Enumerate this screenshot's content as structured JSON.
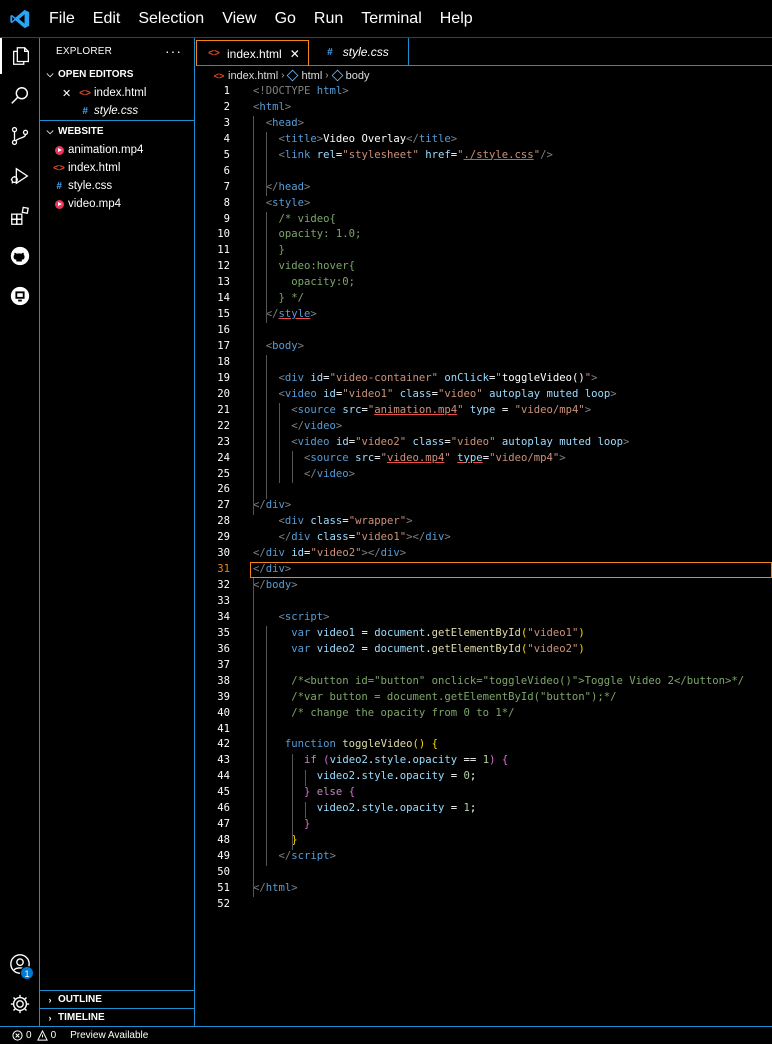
{
  "menu": [
    "File",
    "Edit",
    "Selection",
    "View",
    "Go",
    "Run",
    "Terminal",
    "Help"
  ],
  "activity": {
    "icons": [
      "explorer-icon",
      "search-icon",
      "source-control-icon",
      "run-debug-icon",
      "extensions-icon",
      "github-icon",
      "remote-explorer-icon"
    ],
    "accounts_badge": "1"
  },
  "sidebar": {
    "title": "EXPLORER",
    "more": "···",
    "open_editors": {
      "label": "OPEN EDITORS",
      "items": [
        {
          "name": "index.html",
          "type": "html",
          "close": "✕"
        },
        {
          "name": "style.css",
          "type": "css"
        }
      ]
    },
    "workspace": {
      "label": "WEBSITE",
      "items": [
        {
          "name": "animation.mp4",
          "type": "mp4"
        },
        {
          "name": "index.html",
          "type": "html"
        },
        {
          "name": "style.css",
          "type": "css"
        },
        {
          "name": "video.mp4",
          "type": "mp4"
        }
      ]
    },
    "outline_label": "OUTLINE",
    "timeline_label": "TIMELINE"
  },
  "tabs": [
    {
      "label": "index.html",
      "icon": "<>",
      "close": "✕"
    },
    {
      "label": "style.css",
      "icon": "#"
    }
  ],
  "breadcrumb": [
    "index.html",
    "html",
    "body"
  ],
  "status": {
    "errors": "0",
    "warnings": "0",
    "preview": "Preview Available"
  },
  "colors": {
    "accent": "#1b8fd0",
    "active_border": "#f38518",
    "background": "#000000"
  },
  "editor": {
    "current_line": 31,
    "lines": [
      {
        "n": "1",
        "t": [
          [
            "<!DOCTYPE ",
            "g"
          ],
          [
            "html",
            "k"
          ],
          [
            ">",
            "g"
          ]
        ]
      },
      {
        "n": "2",
        "t": [
          [
            "<",
            "g"
          ],
          [
            "html",
            "t"
          ],
          [
            ">",
            "g"
          ]
        ]
      },
      {
        "n": "3",
        "t": [
          [
            "  <",
            "g"
          ],
          [
            "head",
            "t"
          ],
          [
            ">",
            "g"
          ]
        ]
      },
      {
        "n": "4",
        "t": [
          [
            "    <",
            "g"
          ],
          [
            "title",
            "t"
          ],
          [
            ">",
            "g"
          ],
          [
            "Video Overlay",
            "p"
          ],
          [
            "</",
            "g"
          ],
          [
            "title",
            "t"
          ],
          [
            ">",
            "g"
          ]
        ]
      },
      {
        "n": "5",
        "t": [
          [
            "    <",
            "g"
          ],
          [
            "link ",
            "t"
          ],
          [
            "rel",
            "a"
          ],
          [
            "=",
            "p"
          ],
          [
            "\"stylesheet\"",
            "s"
          ],
          [
            " href",
            "a"
          ],
          [
            "=",
            "p"
          ],
          [
            "\"",
            "s"
          ],
          [
            "./style.css",
            "su"
          ],
          [
            "\"",
            "s"
          ],
          [
            "/>",
            "g"
          ]
        ]
      },
      {
        "n": "6",
        "t": []
      },
      {
        "n": "7",
        "t": [
          [
            "  </",
            "g"
          ],
          [
            "head",
            "t"
          ],
          [
            ">",
            "g"
          ]
        ]
      },
      {
        "n": "8",
        "t": [
          [
            "  <",
            "g"
          ],
          [
            "style",
            "t"
          ],
          [
            ">",
            "g"
          ]
        ]
      },
      {
        "n": "9",
        "t": [
          [
            "    /* video{",
            "c"
          ]
        ]
      },
      {
        "n": "10",
        "t": [
          [
            "    opacity: 1.0;",
            "c"
          ]
        ]
      },
      {
        "n": "11",
        "t": [
          [
            "    }",
            "c"
          ]
        ]
      },
      {
        "n": "12",
        "t": [
          [
            "    video:hover{",
            "c"
          ]
        ]
      },
      {
        "n": "13",
        "t": [
          [
            "      opacity:0;",
            "c"
          ]
        ]
      },
      {
        "n": "14",
        "t": [
          [
            "    } */",
            "c"
          ]
        ]
      },
      {
        "n": "15",
        "t": [
          [
            "  </",
            "g"
          ],
          [
            "style",
            "tu"
          ],
          [
            ">",
            "g"
          ]
        ]
      },
      {
        "n": "16",
        "t": []
      },
      {
        "n": "17",
        "t": [
          [
            "  <",
            "g"
          ],
          [
            "body",
            "t"
          ],
          [
            ">",
            "g"
          ]
        ]
      },
      {
        "n": "18",
        "t": []
      },
      {
        "n": "19",
        "t": [
          [
            "    <",
            "g"
          ],
          [
            "div ",
            "t"
          ],
          [
            "id",
            "a"
          ],
          [
            "=",
            "p"
          ],
          [
            "\"video-container\"",
            "s"
          ],
          [
            " onClick",
            "a"
          ],
          [
            "=",
            "p"
          ],
          [
            "\"",
            "s"
          ],
          [
            "toggleVideo()",
            "p"
          ],
          [
            "\"",
            "s"
          ],
          [
            ">",
            "g"
          ]
        ]
      },
      {
        "n": "20",
        "t": [
          [
            "    <",
            "g"
          ],
          [
            "video ",
            "t"
          ],
          [
            "id",
            "a"
          ],
          [
            "=",
            "p"
          ],
          [
            "\"video1\"",
            "s"
          ],
          [
            " class",
            "a"
          ],
          [
            "=",
            "p"
          ],
          [
            "\"video\"",
            "s"
          ],
          [
            " autoplay muted loop",
            "a"
          ],
          [
            ">",
            "g"
          ]
        ]
      },
      {
        "n": "21",
        "t": [
          [
            "      <",
            "g"
          ],
          [
            "source ",
            "t"
          ],
          [
            "src",
            "a"
          ],
          [
            "=",
            "p"
          ],
          [
            "\"",
            "s"
          ],
          [
            "animation.mp4",
            "su"
          ],
          [
            "\"",
            "s"
          ],
          [
            " type ",
            "a"
          ],
          [
            "= ",
            "p"
          ],
          [
            "\"video/mp4\"",
            "s"
          ],
          [
            ">",
            "g"
          ]
        ]
      },
      {
        "n": "22",
        "t": [
          [
            "      </",
            "g"
          ],
          [
            "video",
            "t"
          ],
          [
            ">",
            "g"
          ]
        ]
      },
      {
        "n": "23",
        "t": [
          [
            "      <",
            "g"
          ],
          [
            "video ",
            "t"
          ],
          [
            "id",
            "a"
          ],
          [
            "=",
            "p"
          ],
          [
            "\"video2\"",
            "s"
          ],
          [
            " class",
            "a"
          ],
          [
            "=",
            "p"
          ],
          [
            "\"video\"",
            "s"
          ],
          [
            " autoplay muted loop",
            "a"
          ],
          [
            ">",
            "g"
          ]
        ]
      },
      {
        "n": "24",
        "t": [
          [
            "        <",
            "g"
          ],
          [
            "source ",
            "t"
          ],
          [
            "src",
            "a"
          ],
          [
            "=",
            "p"
          ],
          [
            "\"",
            "s"
          ],
          [
            "video.mp4",
            "su"
          ],
          [
            "\"",
            "s"
          ],
          [
            " ",
            "p"
          ],
          [
            "type",
            "au"
          ],
          [
            "=",
            "p"
          ],
          [
            "\"video/mp4\"",
            "s"
          ],
          [
            ">",
            "g"
          ]
        ]
      },
      {
        "n": "25",
        "t": [
          [
            "        </",
            "g"
          ],
          [
            "video",
            "t"
          ],
          [
            ">",
            "g"
          ]
        ]
      },
      {
        "n": "26",
        "t": []
      },
      {
        "n": "27",
        "t": [
          [
            "</",
            "g"
          ],
          [
            "div",
            "t"
          ],
          [
            ">",
            "g"
          ]
        ]
      },
      {
        "n": "28",
        "t": [
          [
            "    <",
            "g"
          ],
          [
            "div ",
            "t"
          ],
          [
            "class",
            "a"
          ],
          [
            "=",
            "p"
          ],
          [
            "\"wrapper\"",
            "s"
          ],
          [
            ">",
            "g"
          ]
        ]
      },
      {
        "n": "29",
        "t": [
          [
            "    </",
            "g"
          ],
          [
            "div ",
            "t"
          ],
          [
            "class",
            "a"
          ],
          [
            "=",
            "p"
          ],
          [
            "\"video1\"",
            "s"
          ],
          [
            "></",
            "g"
          ],
          [
            "div",
            "t"
          ],
          [
            ">",
            "g"
          ]
        ]
      },
      {
        "n": "30",
        "t": [
          [
            "</",
            "g"
          ],
          [
            "div ",
            "t"
          ],
          [
            "id",
            "a"
          ],
          [
            "=",
            "p"
          ],
          [
            "\"video2\"",
            "s"
          ],
          [
            "></",
            "g"
          ],
          [
            "div",
            "t"
          ],
          [
            ">",
            "g"
          ]
        ]
      },
      {
        "n": "31",
        "t": [
          [
            "</",
            "g"
          ],
          [
            "div",
            "t"
          ],
          [
            ">",
            "g"
          ]
        ]
      },
      {
        "n": "32",
        "t": [
          [
            "</",
            "g"
          ],
          [
            "body",
            "t"
          ],
          [
            ">",
            "g"
          ]
        ]
      },
      {
        "n": "33",
        "t": []
      },
      {
        "n": "34",
        "t": [
          [
            "    <",
            "g"
          ],
          [
            "script",
            "t"
          ],
          [
            ">",
            "g"
          ]
        ]
      },
      {
        "n": "35",
        "t": [
          [
            "      ",
            "p"
          ],
          [
            "var ",
            "k"
          ],
          [
            "video1",
            "v"
          ],
          [
            " = ",
            "p"
          ],
          [
            "document",
            "v"
          ],
          [
            ".",
            "p"
          ],
          [
            "getElementById",
            "f"
          ],
          [
            "(",
            "y"
          ],
          [
            "\"video1\"",
            "s"
          ],
          [
            ")",
            "y"
          ]
        ]
      },
      {
        "n": "36",
        "t": [
          [
            "      ",
            "p"
          ],
          [
            "var ",
            "k"
          ],
          [
            "video2",
            "v"
          ],
          [
            " = ",
            "p"
          ],
          [
            "document",
            "v"
          ],
          [
            ".",
            "p"
          ],
          [
            "getElementById",
            "f"
          ],
          [
            "(",
            "y"
          ],
          [
            "\"video2\"",
            "s"
          ],
          [
            ")",
            "y"
          ]
        ]
      },
      {
        "n": "37",
        "t": []
      },
      {
        "n": "38",
        "t": [
          [
            "      /*<button id=\"button\" onclick=\"toggleVideo()\">Toggle Video 2</button>*/",
            "c"
          ]
        ]
      },
      {
        "n": "39",
        "t": [
          [
            "      /*var button = document.getElementById(\"button\");*/",
            "c"
          ]
        ]
      },
      {
        "n": "40",
        "t": [
          [
            "      /* change the opacity from 0 to 1*/",
            "c"
          ]
        ]
      },
      {
        "n": "41",
        "t": []
      },
      {
        "n": "42",
        "t": [
          [
            "     ",
            "p"
          ],
          [
            "function ",
            "k"
          ],
          [
            "toggleVideo",
            "f"
          ],
          [
            "() ",
            "y"
          ],
          [
            "{",
            "y"
          ]
        ]
      },
      {
        "n": "43",
        "t": [
          [
            "        ",
            "p"
          ],
          [
            "if ",
            "cf"
          ],
          [
            "(",
            "m"
          ],
          [
            "video2",
            "v"
          ],
          [
            ".",
            "p"
          ],
          [
            "style",
            "v"
          ],
          [
            ".",
            "p"
          ],
          [
            "opacity",
            "v"
          ],
          [
            " == ",
            "p"
          ],
          [
            "1",
            "n"
          ],
          [
            ") ",
            "m"
          ],
          [
            "{",
            "m"
          ]
        ]
      },
      {
        "n": "44",
        "t": [
          [
            "          ",
            "p"
          ],
          [
            "video2",
            "v"
          ],
          [
            ".",
            "p"
          ],
          [
            "style",
            "v"
          ],
          [
            ".",
            "p"
          ],
          [
            "opacity",
            "v"
          ],
          [
            " = ",
            "p"
          ],
          [
            "0",
            "n"
          ],
          [
            ";",
            "p"
          ]
        ]
      },
      {
        "n": "45",
        "t": [
          [
            "        ",
            "p"
          ],
          [
            "} ",
            "m"
          ],
          [
            "else ",
            "cf"
          ],
          [
            "{",
            "m"
          ]
        ]
      },
      {
        "n": "46",
        "t": [
          [
            "          ",
            "p"
          ],
          [
            "video2",
            "v"
          ],
          [
            ".",
            "p"
          ],
          [
            "style",
            "v"
          ],
          [
            ".",
            "p"
          ],
          [
            "opacity",
            "v"
          ],
          [
            " = ",
            "p"
          ],
          [
            "1",
            "n"
          ],
          [
            ";",
            "p"
          ]
        ]
      },
      {
        "n": "47",
        "t": [
          [
            "        ",
            "p"
          ],
          [
            "}",
            "m"
          ]
        ]
      },
      {
        "n": "48",
        "t": [
          [
            "      ",
            "p"
          ],
          [
            "}",
            "y"
          ]
        ]
      },
      {
        "n": "49",
        "t": [
          [
            "    </",
            "g"
          ],
          [
            "script",
            "t"
          ],
          [
            ">",
            "g"
          ]
        ]
      },
      {
        "n": "50",
        "t": []
      },
      {
        "n": "51",
        "t": [
          [
            "</",
            "g"
          ],
          [
            "html",
            "t"
          ],
          [
            ">",
            "g"
          ]
        ]
      },
      {
        "n": "52",
        "t": []
      }
    ]
  }
}
